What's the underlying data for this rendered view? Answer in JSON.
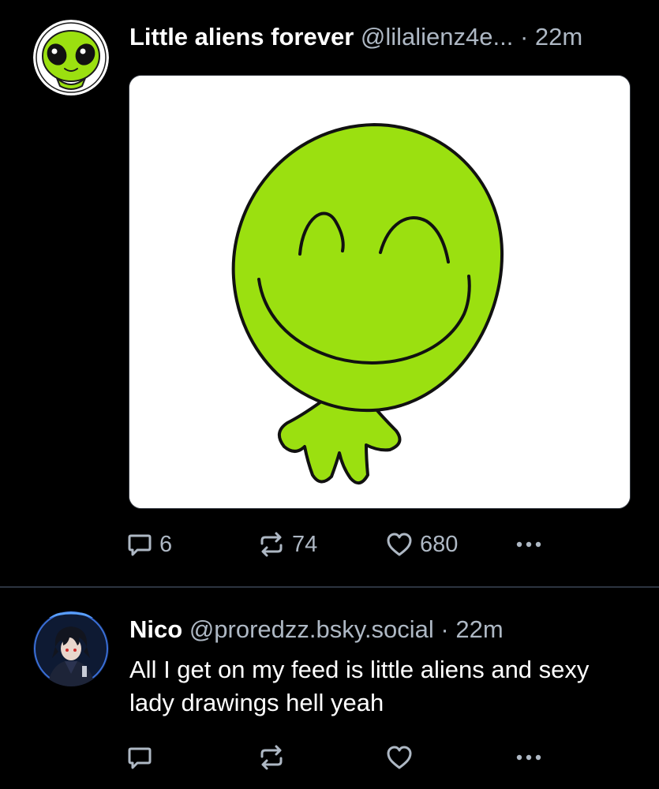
{
  "posts": [
    {
      "author_name": "Little aliens forever",
      "handle": "@lilalienz4e...",
      "separator": " · ",
      "time": "22m",
      "text": "",
      "has_image": true,
      "counts": {
        "replies": "6",
        "reposts": "74",
        "likes": "680"
      }
    },
    {
      "author_name": "Nico",
      "handle": "@proredzz.bsky.social",
      "separator": " · ",
      "time": "22m",
      "text": "All I get on my feed is little aliens and sexy lady drawings hell yeah",
      "has_image": false,
      "counts": {
        "replies": "",
        "reposts": "",
        "likes": ""
      }
    }
  ],
  "icons": {
    "reply": "speech-bubble-icon",
    "repost": "repost-arrows-icon",
    "like": "heart-icon",
    "more": "ellipsis-icon"
  },
  "colors": {
    "background": "#000000",
    "text": "#ffffff",
    "muted": "#aeb8c4",
    "divider": "#2c3440",
    "alien_green": "#9be010"
  }
}
